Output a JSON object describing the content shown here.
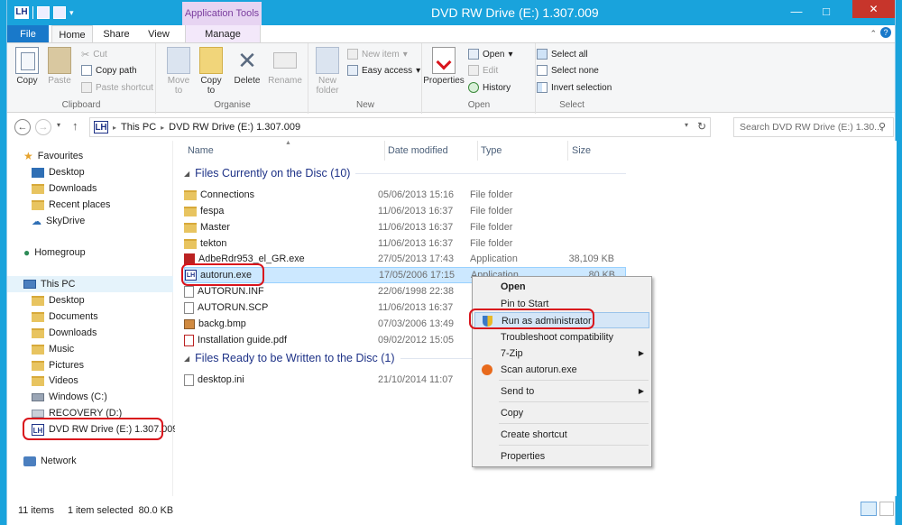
{
  "window": {
    "title": "DVD RW Drive (E:) 1.307.009",
    "app_tools": "Application Tools"
  },
  "tabs": {
    "file": "File",
    "home": "Home",
    "share": "Share",
    "view": "View",
    "manage": "Manage"
  },
  "ribbon": {
    "clipboard": {
      "label": "Clipboard",
      "copy": "Copy",
      "paste": "Paste",
      "cut": "Cut",
      "copy_path": "Copy path",
      "paste_shortcut": "Paste shortcut"
    },
    "organise": {
      "label": "Organise",
      "move_to": "Move",
      "move_to2": "to",
      "copy_to": "Copy",
      "copy_to2": "to",
      "delete": "Delete",
      "rename": "Rename"
    },
    "new": {
      "label": "New",
      "new_folder": "New",
      "new_folder2": "folder",
      "new_item": "New item",
      "easy_access": "Easy access"
    },
    "open": {
      "label": "Open",
      "properties": "Properties",
      "open": "Open",
      "edit": "Edit",
      "history": "History"
    },
    "select": {
      "label": "Select",
      "select_all": "Select all",
      "select_none": "Select none",
      "invert": "Invert selection"
    }
  },
  "address": {
    "this_pc": "This PC",
    "drive": "DVD RW Drive (E:) 1.307.009",
    "search_placeholder": "Search DVD RW Drive (E:) 1.30..."
  },
  "nav": {
    "favourites": "Favourites",
    "fav_items": [
      "Desktop",
      "Downloads",
      "Recent places",
      "SkyDrive"
    ],
    "homegroup": "Homegroup",
    "this_pc": "This PC",
    "pc_items": [
      "Desktop",
      "Documents",
      "Downloads",
      "Music",
      "Pictures",
      "Videos",
      "Windows (C:)",
      "RECOVERY (D:)"
    ],
    "dvd": "DVD RW Drive (E:) 1.307.009",
    "network": "Network"
  },
  "columns": {
    "name": "Name",
    "date": "Date modified",
    "type": "Type",
    "size": "Size"
  },
  "groups": {
    "on_disc": "Files Currently on the Disc (10)",
    "ready": "Files Ready to be Written to the Disc (1)"
  },
  "files": [
    {
      "name": "Connections",
      "date": "05/06/2013 15:16",
      "type": "File folder",
      "size": ""
    },
    {
      "name": "fespa",
      "date": "11/06/2013 16:37",
      "type": "File folder",
      "size": ""
    },
    {
      "name": "Master",
      "date": "11/06/2013 16:37",
      "type": "File folder",
      "size": ""
    },
    {
      "name": "tekton",
      "date": "11/06/2013 16:37",
      "type": "File folder",
      "size": ""
    },
    {
      "name": "AdbeRdr953_el_GR.exe",
      "date": "27/05/2013 17:43",
      "type": "Application",
      "size": "38,109 KB"
    },
    {
      "name": "autorun.exe",
      "date": "17/05/2006 17:15",
      "type": "Application",
      "size": "80 KB"
    },
    {
      "name": "AUTORUN.INF",
      "date": "22/06/1998 22:38",
      "type": "",
      "size": ""
    },
    {
      "name": "AUTORUN.SCP",
      "date": "11/06/2013 16:37",
      "type": "",
      "size": ""
    },
    {
      "name": "backg.bmp",
      "date": "07/03/2006 13:49",
      "type": "",
      "size": ""
    },
    {
      "name": "Installation guide.pdf",
      "date": "09/02/2012 15:05",
      "type": "",
      "size": ""
    }
  ],
  "ready_files": [
    {
      "name": "desktop.ini",
      "date": "21/10/2014 11:07",
      "type": "",
      "size": ""
    }
  ],
  "context_menu": {
    "open": "Open",
    "pin_to_start": "Pin to Start",
    "run_as_admin": "Run as administrator",
    "troubleshoot": "Troubleshoot compatibility",
    "seven_zip": "7-Zip",
    "scan": "Scan autorun.exe",
    "send_to": "Send to",
    "copy": "Copy",
    "create_shortcut": "Create shortcut",
    "properties": "Properties"
  },
  "status": {
    "items": "11 items",
    "selected": "1 item selected  80.0 KB"
  },
  "colors": {
    "accent": "#19a3dc",
    "highlight": "#d9141c",
    "selection": "#cce8ff"
  }
}
